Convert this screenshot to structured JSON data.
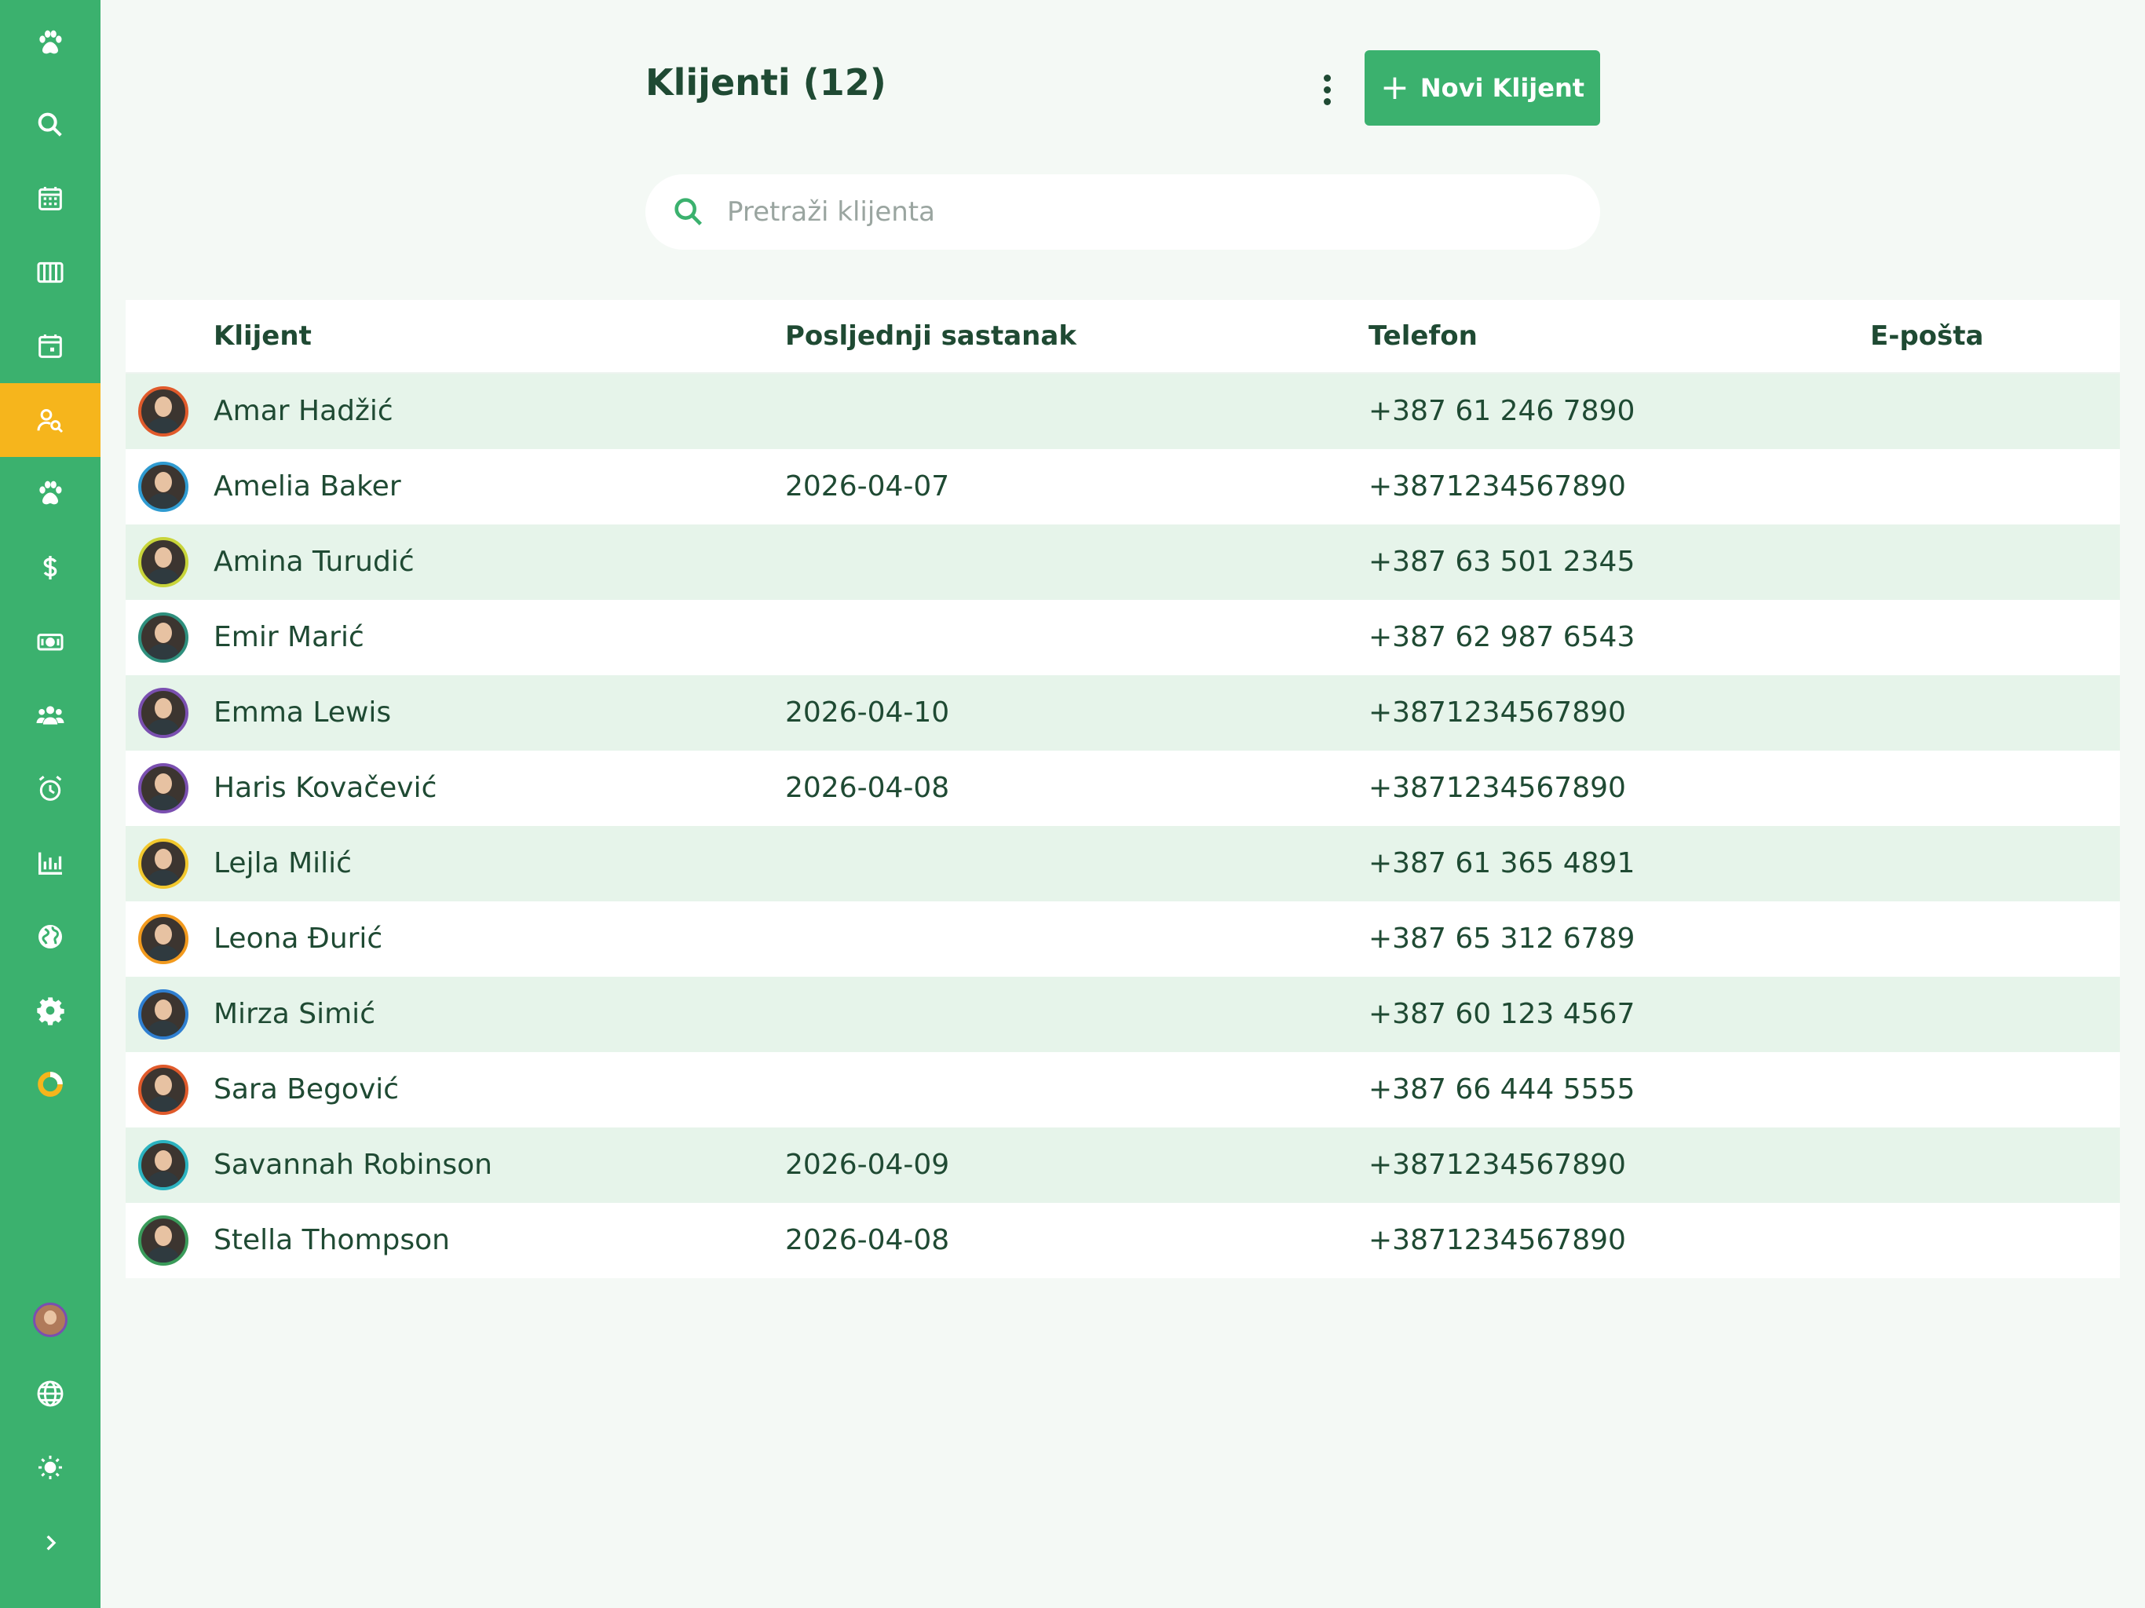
{
  "sidebar": {
    "items": [
      {
        "icon": "paw-icon"
      },
      {
        "icon": "search-icon"
      },
      {
        "icon": "calendar-grid-icon"
      },
      {
        "icon": "columns-icon"
      },
      {
        "icon": "calendar-day-icon"
      },
      {
        "icon": "client-search-icon",
        "active": true
      },
      {
        "icon": "paw-icon"
      },
      {
        "icon": "dollar-icon"
      },
      {
        "icon": "money-bill-icon"
      },
      {
        "icon": "users-icon"
      },
      {
        "icon": "alarm-clock-icon"
      },
      {
        "icon": "bar-chart-icon"
      },
      {
        "icon": "globe-icon"
      },
      {
        "icon": "gear-icon"
      },
      {
        "icon": "donut-chart-icon"
      }
    ],
    "bottom": [
      {
        "icon": "user-avatar"
      },
      {
        "icon": "language-globe-icon"
      },
      {
        "icon": "sun-icon"
      },
      {
        "icon": "chevron-right-icon"
      }
    ]
  },
  "header": {
    "title": "Klijenti (12)",
    "new_button_label": "Novi Klijent"
  },
  "search": {
    "placeholder": "Pretraži klijenta",
    "value": ""
  },
  "table": {
    "columns": [
      "Klijent",
      "Posljednji sastanak",
      "Telefon",
      "E-pošta"
    ],
    "rows": [
      {
        "name": "Amar Hadžić",
        "last_meeting": "",
        "phone": "+387 61 246 7890",
        "email": "",
        "ring": "#e05a2b"
      },
      {
        "name": "Amelia Baker",
        "last_meeting": "2026-04-07",
        "phone": "+3871234567890",
        "email": "",
        "ring": "#2f9bd1"
      },
      {
        "name": "Amina Turudić",
        "last_meeting": "",
        "phone": "+387 63 501 2345",
        "email": "",
        "ring": "#c8d43a"
      },
      {
        "name": "Emir Marić",
        "last_meeting": "",
        "phone": "+387 62 987 6543",
        "email": "",
        "ring": "#2e8f7d"
      },
      {
        "name": "Emma Lewis",
        "last_meeting": "2026-04-10",
        "phone": "+3871234567890",
        "email": "",
        "ring": "#7a4fb0"
      },
      {
        "name": "Haris Kovačević",
        "last_meeting": "2026-04-08",
        "phone": "+3871234567890",
        "email": "",
        "ring": "#7a4fb0"
      },
      {
        "name": "Lejla Milić",
        "last_meeting": "",
        "phone": "+387 61 365 4891",
        "email": "",
        "ring": "#f2c82e"
      },
      {
        "name": "Leona Đurić",
        "last_meeting": "",
        "phone": "+387 65 312 6789",
        "email": "",
        "ring": "#f29a1e"
      },
      {
        "name": "Mirza Simić",
        "last_meeting": "",
        "phone": "+387 60 123 4567",
        "email": "",
        "ring": "#2f7fd1"
      },
      {
        "name": "Sara Begović",
        "last_meeting": "",
        "phone": "+387 66 444 5555",
        "email": "",
        "ring": "#e05a2b"
      },
      {
        "name": "Savannah Robinson",
        "last_meeting": "2026-04-09",
        "phone": "+3871234567890",
        "email": "",
        "ring": "#2bb3c0"
      },
      {
        "name": "Stella Thompson",
        "last_meeting": "2026-04-08",
        "phone": "+3871234567890",
        "email": "",
        "ring": "#3a9b5a"
      }
    ]
  },
  "colors": {
    "sidebar": "#3bb16e",
    "active": "#f6b51c",
    "accent": "#3bb16e",
    "text": "#1f4a33",
    "row_alt": "#e6f4ea"
  }
}
